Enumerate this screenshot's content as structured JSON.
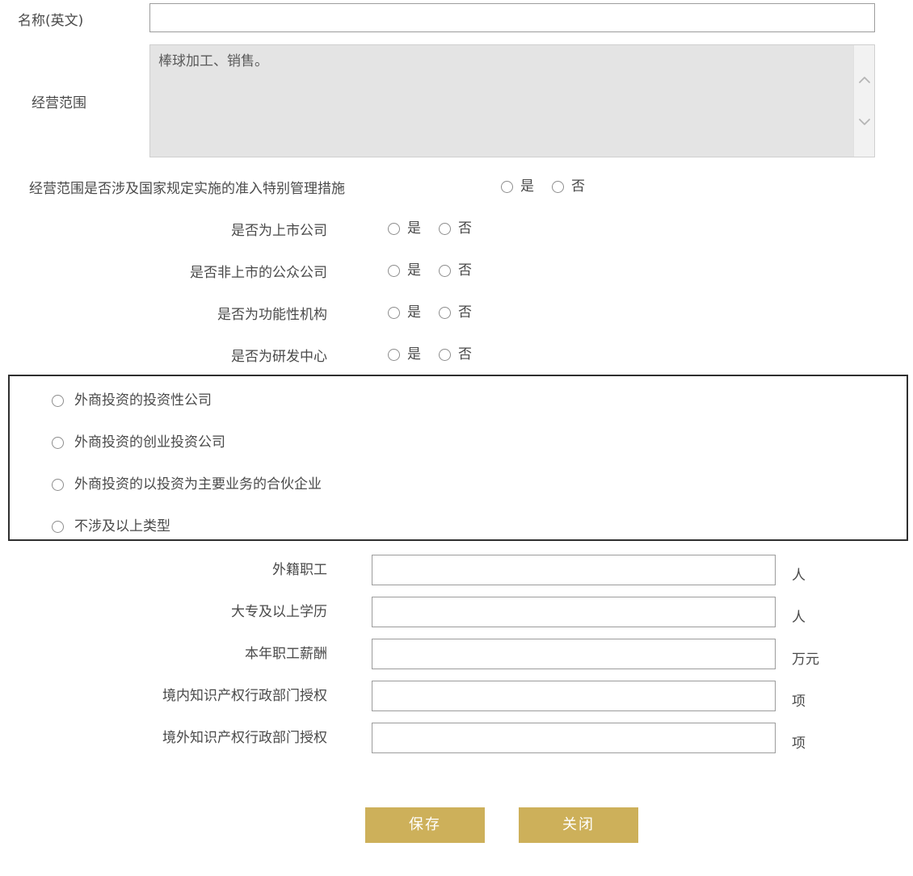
{
  "form": {
    "name_en": {
      "label": "名称(英文)",
      "value": "",
      "placeholder": ""
    },
    "business_scope": {
      "label": "经营范围",
      "value": "棒球加工、销售。",
      "readonly": true,
      "scrollbar": {
        "up_icon": "chevron-up-icon",
        "down_icon": "chevron-down-icon"
      }
    },
    "yes_no_options": [
      "是",
      "否"
    ],
    "questions": [
      {
        "label": "经营范围是否涉及国家规定实施的准入特别管理措施",
        "layout": "wide",
        "selected": null
      },
      {
        "label": "是否为上市公司",
        "layout": "normal",
        "selected": null
      },
      {
        "label": "是否非上市的公众公司",
        "layout": "normal",
        "selected": null
      },
      {
        "label": "是否为功能性机构",
        "layout": "normal",
        "selected": null
      },
      {
        "label": "是否为研发中心",
        "layout": "normal",
        "selected": null
      }
    ],
    "investment_types": {
      "selected": null,
      "options": [
        "外商投资的投资性公司",
        "外商投资的创业投资公司",
        "外商投资的以投资为主要业务的合伙企业",
        "不涉及以上类型"
      ]
    },
    "numeric_fields": [
      {
        "label": "外籍职工",
        "value": "",
        "unit": "人"
      },
      {
        "label": "大专及以上学历",
        "value": "",
        "unit": "人"
      },
      {
        "label": "本年职工薪酬",
        "value": "",
        "unit": "万元"
      },
      {
        "label": "境内知识产权行政部门授权",
        "value": "",
        "unit": "项"
      },
      {
        "label": "境外知识产权行政部门授权",
        "value": "",
        "unit": "项"
      }
    ],
    "buttons": {
      "save": "保存",
      "close": "关闭"
    }
  },
  "colors": {
    "button_gold": "#cdb05a",
    "input_border": "#9c9c9c",
    "textarea_bg": "#e4e4e4",
    "box_border": "#2f2f2f",
    "text": "#4a4a4a"
  }
}
